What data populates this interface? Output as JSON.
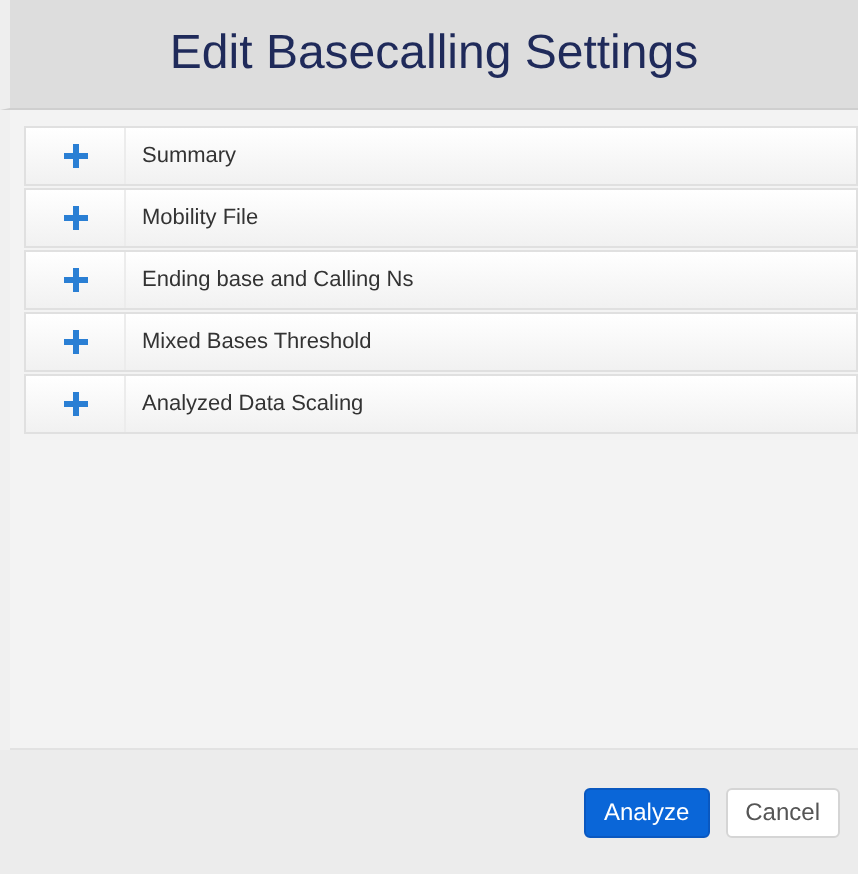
{
  "dialog": {
    "title": "Edit Basecalling Settings"
  },
  "sections": [
    {
      "label": "Summary",
      "expanded": false
    },
    {
      "label": "Mobility File",
      "expanded": false
    },
    {
      "label": "Ending base and Calling Ns",
      "expanded": false
    },
    {
      "label": "Mixed Bases Threshold",
      "expanded": false
    },
    {
      "label": "Analyzed Data Scaling",
      "expanded": false
    }
  ],
  "buttons": [
    {
      "label": "Analyze",
      "kind": "primary"
    },
    {
      "label": "Cancel",
      "kind": "secondary"
    }
  ]
}
